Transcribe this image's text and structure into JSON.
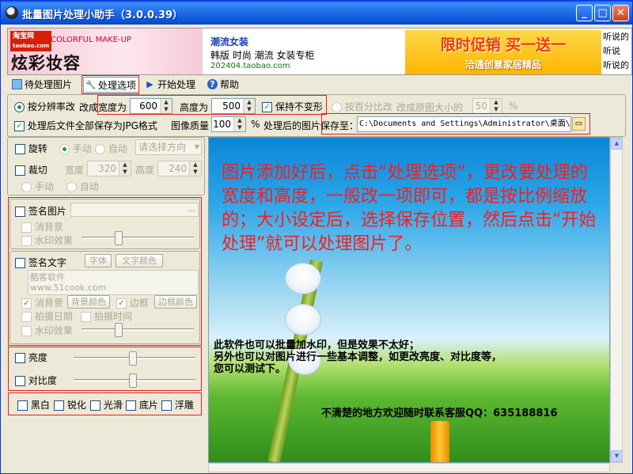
{
  "window": {
    "title": "批量图片处理小助手（3.0.0.39）",
    "min": "_",
    "max": "□",
    "close": "✕"
  },
  "ads": {
    "ad1": {
      "logo": "淘宝网",
      "logo_sub": "taobao.com",
      "tagline": "COLORFUL MAKE-UP",
      "big": "炫彩妆容"
    },
    "ad2": {
      "title": "潮流女装",
      "line": "韩版 时尚 潮流 女装专柜",
      "url": "202404.taobao.com"
    },
    "ad3": {
      "big": "限时促销 买一送一",
      "small": "洽通创意家居精品"
    },
    "ad4": [
      "听说的",
      "听说",
      "听说的"
    ]
  },
  "toolbar": {
    "items": [
      {
        "label": "待处理图片",
        "icon": "image-list-icon"
      },
      {
        "label": "处理选项",
        "icon": "tools-icon"
      },
      {
        "label": "开始处理",
        "icon": "play-icon"
      },
      {
        "label": "帮助",
        "icon": "help-icon"
      }
    ]
  },
  "options": {
    "by_resolution": "按分辨率改",
    "change_width": "改成宽度为",
    "width": "600",
    "height_label": "高度为",
    "height": "500",
    "keep_ratio": "保持不变形",
    "by_percent": "按百分比改",
    "percent_label": "改成原图大小的",
    "percent": "50",
    "percent_unit": "%",
    "save_jpg": "处理后文件全部保存为JPG格式",
    "quality_label": "图像质量",
    "quality": "100",
    "quality_unit": "%",
    "save_to_label": "处理后的图片保存至：",
    "save_path": "C:\\Documents and Settings\\Administrator\\桌面\\"
  },
  "left": {
    "rotate": "旋转",
    "manual": "手动",
    "auto": "自动",
    "direction_placeholder": "请选择方向",
    "crop": "裁切",
    "crop_w_label": "宽度",
    "crop_w": "320",
    "crop_h_label": "高度",
    "crop_h": "240",
    "crop_manual": "手动",
    "crop_auto": "自动",
    "sign_image": "签名图片",
    "sign_image_path": "...",
    "remove_bg": "消背景",
    "watermark": "水印效果",
    "sign_text": "签名文字",
    "font_btn": "字体",
    "color_btn": "文字颜色",
    "sign_text_value": "酷客软件\nwww.51cook.com",
    "remove_bg2": "消背景",
    "bg_color_btn": "背景颜色",
    "border": "边框",
    "border_color_btn": "边框颜色",
    "shoot_date": "拍摄日期",
    "shoot_time": "拍摄时间",
    "watermark2": "水印效果",
    "brightness": "亮度",
    "contrast": "对比度",
    "effects": [
      "黑白",
      "锐化",
      "光滑",
      "底片",
      "浮雕"
    ]
  },
  "preview": {
    "instruction": "图片添加好后，点击“处理选项”，更改要处理的宽度和高度，一般改一项即可，都是按比例缩放的；大小设定后，选择保存位置，然后点击“开始处理”就可以处理图片了。",
    "note1": "此软件也可以批量加水印，但是效果不太好；",
    "note2": "另外也可以对图片进行一些基本调整，如更改亮度、对比度等，",
    "note3": "您可以测试下。",
    "contact": "不清楚的地方欢迎随时联系客服QQ：635188816"
  },
  "colors": {
    "accent_red": "#e0201c",
    "title_blue": "#0a5ce8"
  }
}
